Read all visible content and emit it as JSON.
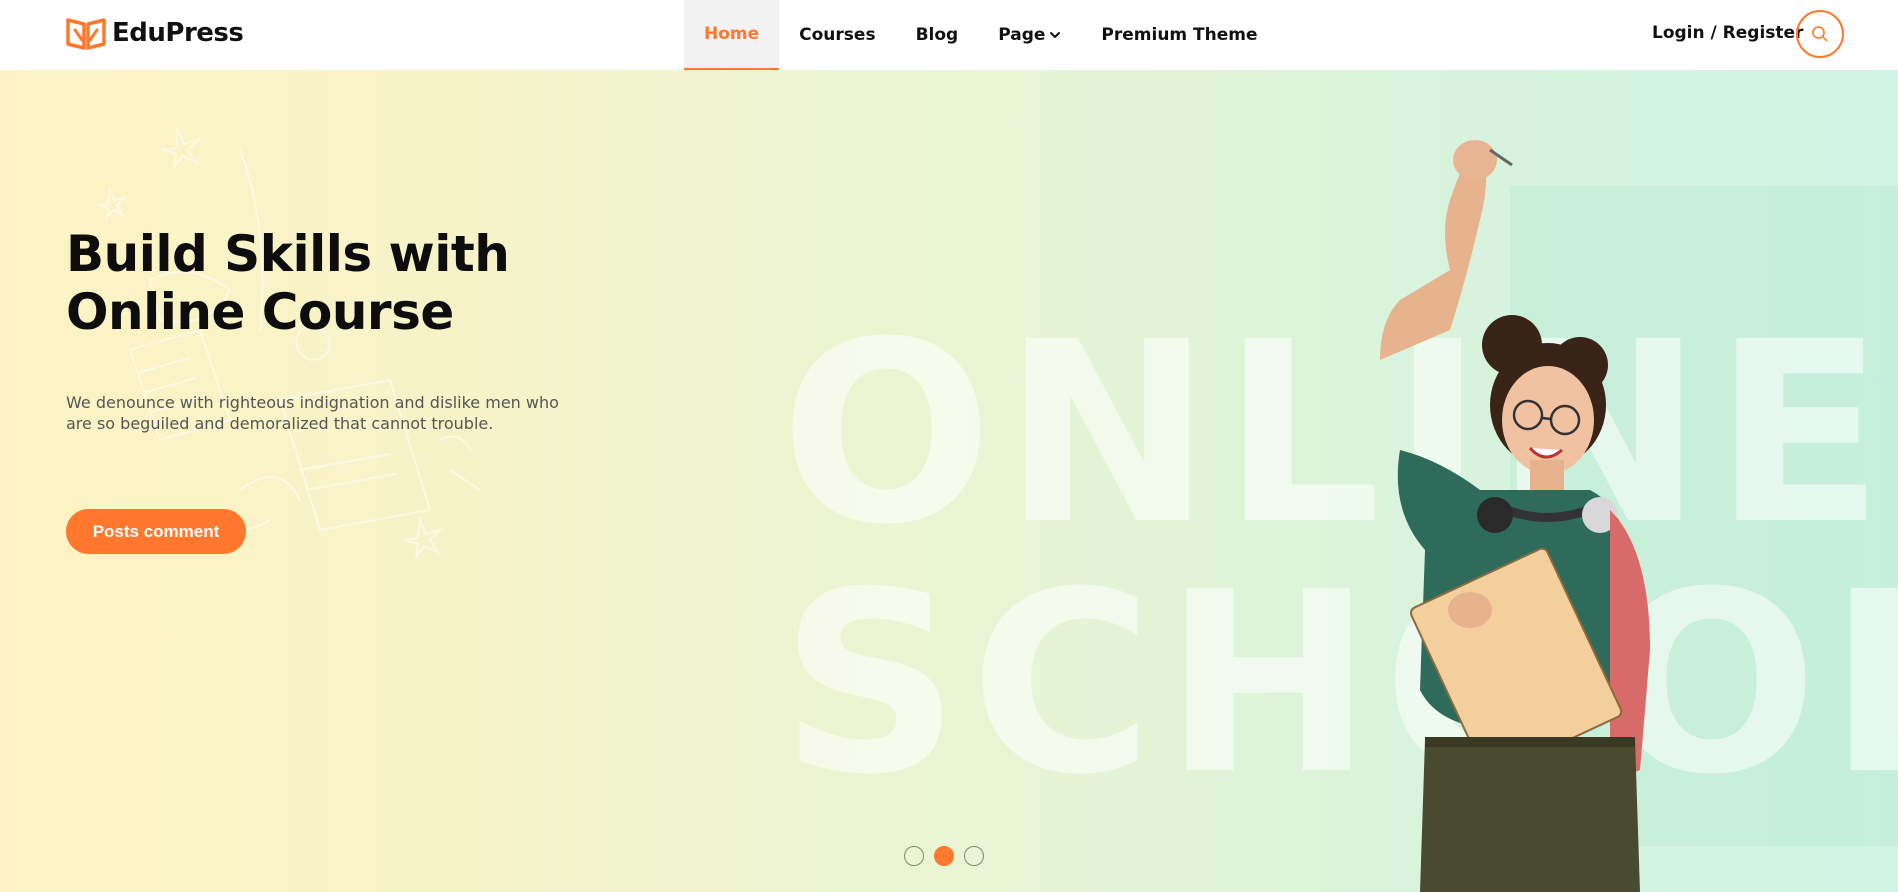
{
  "brand": {
    "name": "EduPress",
    "accent": "#ff782d"
  },
  "nav": {
    "items": [
      {
        "label": "Home",
        "active": true
      },
      {
        "label": "Courses",
        "active": false
      },
      {
        "label": "Blog",
        "active": false
      },
      {
        "label": "Page",
        "active": false,
        "has_dropdown": true
      },
      {
        "label": "Premium Theme",
        "active": false
      }
    ],
    "login_label": "Login / Register",
    "search_icon": "search-icon"
  },
  "hero": {
    "title_line1": "Build Skills with",
    "title_line2": "Online Course",
    "description": "We denounce with righteous indignation and dislike men who are so beguiled and demoralized that cannot trouble.",
    "button_label": "Posts comment",
    "background_text_line1": "ONLINE",
    "background_text_line2": "SCHOOL",
    "slider": {
      "total": 3,
      "active_index": 1
    }
  }
}
